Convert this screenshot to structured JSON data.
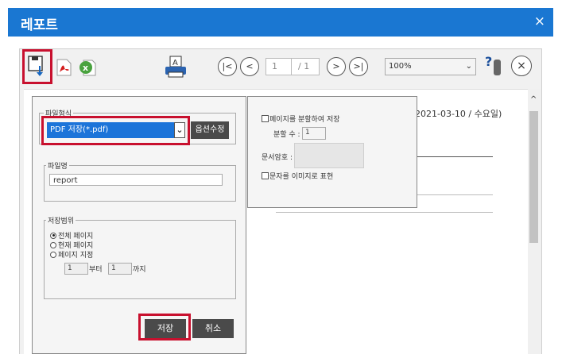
{
  "window": {
    "title": "레포트",
    "close_glyph": "×"
  },
  "toolbar": {
    "page_current": "1",
    "page_total": "/ 1",
    "zoom": "100%",
    "help_glyph": "?",
    "print_icon_letter": "A",
    "icons": [
      "save-download-icon",
      "pdf-icon",
      "excel-icon",
      "print-icon",
      "first-page-icon",
      "prev-page-icon",
      "next-page-icon",
      "last-page-icon",
      "help-icon",
      "close-circle-icon"
    ]
  },
  "report": {
    "date_text": "2021-03-10 / 수요일)"
  },
  "save_dialog": {
    "format_group": "파일형식",
    "format_selected": "PDF 저장(*.pdf)",
    "option_edit_button": "옵션수정",
    "filename_group": "파일명",
    "filename_value": "report",
    "range_group": "저장범위",
    "range_options": [
      "전체 페이지",
      "현재 페이지",
      "페이지 지정"
    ],
    "range_from": "1",
    "range_from_suffix": "부터",
    "range_to": "1",
    "range_to_suffix": "까지",
    "save_button": "저장",
    "cancel_button": "취소"
  },
  "pdf_options": {
    "split_save": "페이지를 분할하여 저장",
    "split_count_label": "분할 수 :",
    "split_count_value": "1",
    "password_label": "문서암호 :",
    "text_as_image": "문자를 이미지로 표현"
  },
  "colors": {
    "titlebar": "#1a77d2",
    "select_highlight": "#1c74d9",
    "highlight_border": "#c8102e",
    "dark_button": "#4a4a4a"
  }
}
